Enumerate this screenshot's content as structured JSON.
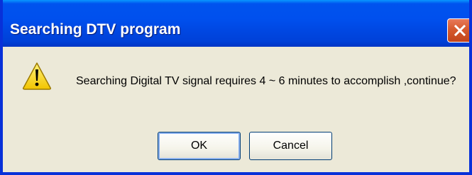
{
  "dialog": {
    "title": "Searching DTV program",
    "message": "Searching Digital TV signal requires 4 ~ 6 minutes to accomplish ,continue?",
    "icon": "warning-icon",
    "buttons": {
      "ok_label": "OK",
      "cancel_label": "Cancel"
    }
  },
  "colors": {
    "titlebar": "#0053EE",
    "dialog_bg": "#ECE9D8",
    "close_button": "#D65A2E",
    "warning_yellow": "#FFD800"
  }
}
